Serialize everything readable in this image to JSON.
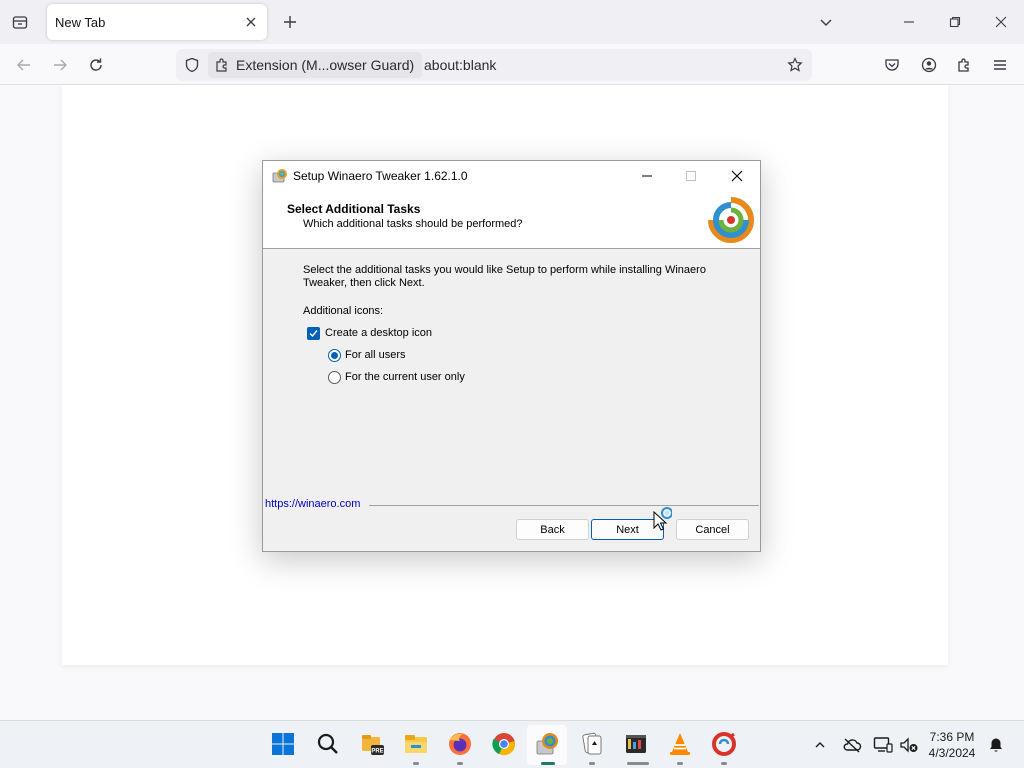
{
  "browser": {
    "tab_title": "New Tab",
    "extension_label": "Extension (M...owser Guard)",
    "url": "about:blank",
    "accent": "#005fb8"
  },
  "dialog": {
    "title": "Setup Winaero Tweaker 1.62.1.0",
    "header_title": "Select Additional Tasks",
    "header_subtitle": "Which additional tasks should be performed?",
    "description": "Select the additional tasks you would like Setup to perform while installing Winaero Tweaker, then click Next.",
    "additional_icons_label": "Additional icons:",
    "checkbox_desktop_icon": {
      "label": "Create a desktop icon",
      "checked": true
    },
    "radio_all_users": {
      "label": "For all users",
      "selected": true
    },
    "radio_current_user": {
      "label": "For the current user only",
      "selected": false
    },
    "link": "https://winaero.com",
    "buttons": {
      "back": "Back",
      "next": "Next",
      "cancel": "Cancel"
    }
  },
  "taskbar": {
    "time": "7:36 PM",
    "date": "4/3/2024",
    "pinned": [
      "start-icon",
      "search-icon",
      "file-explorer-preview-icon",
      "file-explorer-icon",
      "firefox-icon",
      "chrome-icon",
      "winaero-tweaker-icon",
      "solitaire-icon",
      "media-app-icon",
      "vlc-icon",
      "ccleaner-icon"
    ]
  }
}
